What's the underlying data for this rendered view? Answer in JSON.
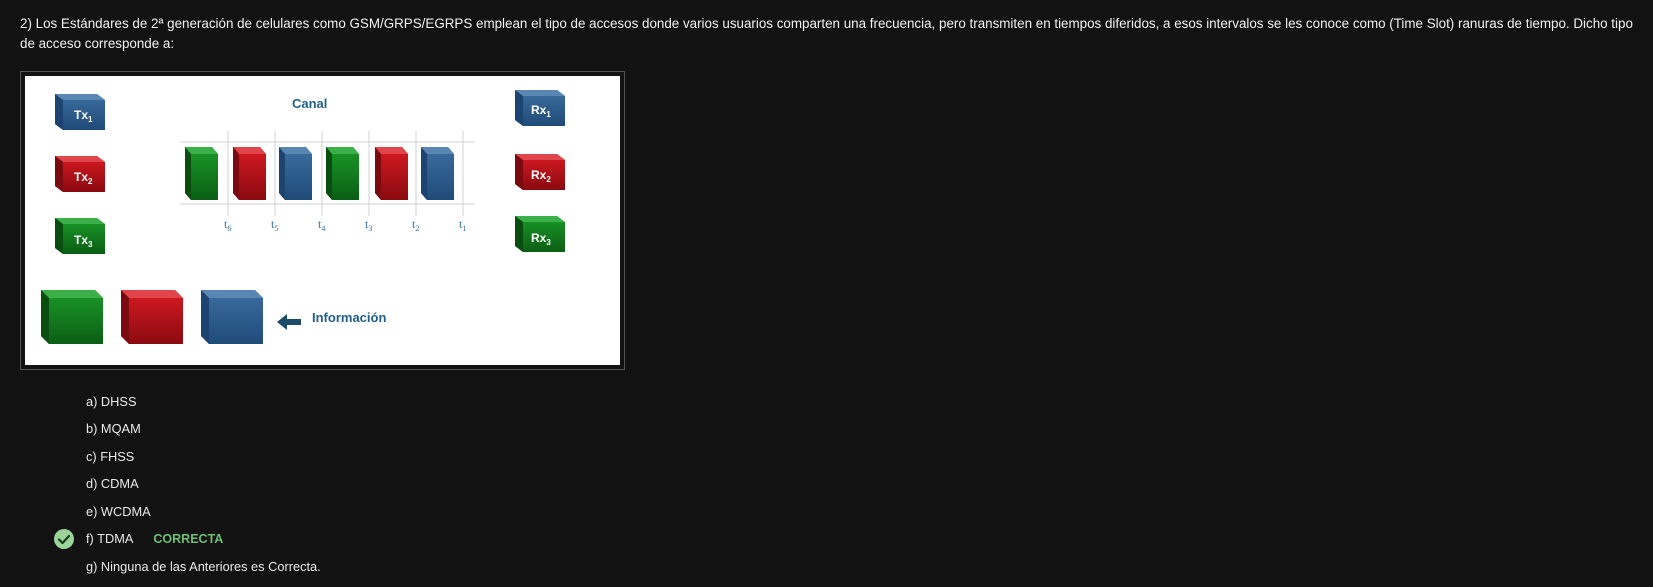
{
  "question": {
    "text": "2) Los Estándares de 2ª generación de celulares como GSM/GRPS/EGRPS emplean el tipo de accesos donde varios usuarios comparten una frecuencia, pero transmiten en tiempos diferidos, a esos intervalos se les conoce como (Time Slot) ranuras de tiempo. Dicho tipo de acceso corresponde a:"
  },
  "figure": {
    "channel_label": "Canal",
    "info_label": "Información",
    "tx_labels": [
      "Tx",
      "Tx",
      "Tx"
    ],
    "tx_subs": [
      "1",
      "2",
      "3"
    ],
    "rx_labels": [
      "Rx",
      "Rx",
      "Rx"
    ],
    "rx_subs": [
      "1",
      "2",
      "3"
    ],
    "time_labels": [
      "t",
      "t",
      "t",
      "t",
      "t",
      "t"
    ],
    "time_subs": [
      "6",
      "5",
      "4",
      "3",
      "2",
      "1"
    ],
    "colors": {
      "blue": "#2f5f8f",
      "red": "#c0121a",
      "green": "#127d1e",
      "text_blue": "#1f5e8a"
    }
  },
  "options": [
    {
      "label": "a) DHSS"
    },
    {
      "label": "b) MQAM"
    },
    {
      "label": "c) FHSS"
    },
    {
      "label": "d) CDMA"
    },
    {
      "label": "e) WCDMA"
    },
    {
      "label": "f) TDMA",
      "tag": "CORRECTA",
      "selected": true
    },
    {
      "label": "g) Ninguna de las Anteriores es Correcta."
    }
  ]
}
